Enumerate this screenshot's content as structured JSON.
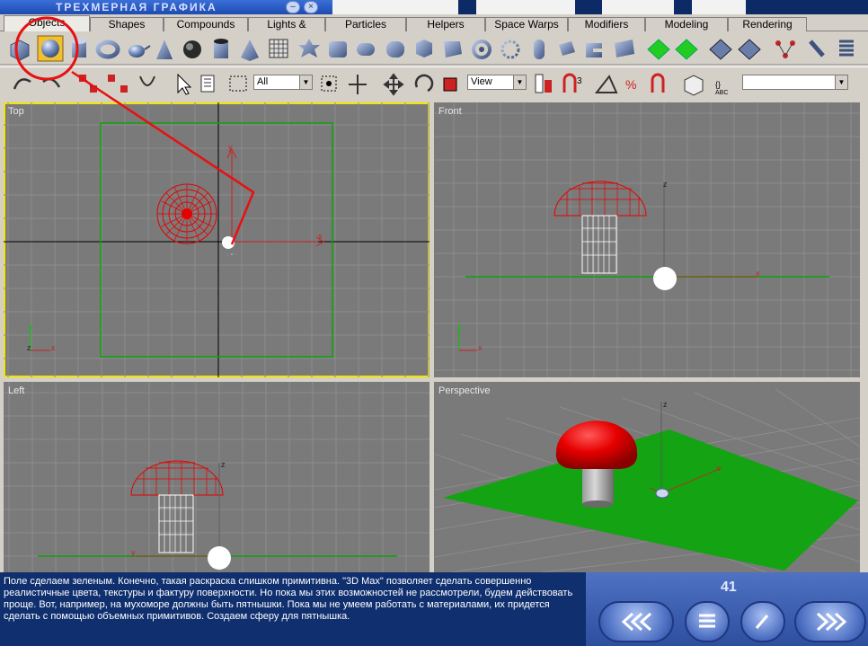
{
  "window": {
    "title": "ТРЕХМЕРНАЯ ГРАФИКА"
  },
  "tabs": [
    {
      "label": "Objects",
      "active": true
    },
    {
      "label": "Shapes"
    },
    {
      "label": "Compounds"
    },
    {
      "label": "Lights & Cameras"
    },
    {
      "label": "Particles"
    },
    {
      "label": "Helpers"
    },
    {
      "label": "Space Warps"
    },
    {
      "label": "Modifiers"
    },
    {
      "label": "Modeling"
    },
    {
      "label": "Rendering"
    }
  ],
  "toolbar": {
    "selection_filter": "All",
    "reference_coord": "View",
    "named_selection": ""
  },
  "viewports": {
    "top": "Top",
    "front": "Front",
    "left": "Left",
    "perspective": "Perspective"
  },
  "axis": {
    "x": "x",
    "y": "y",
    "z": "z"
  },
  "lesson": {
    "text": "Поле сделаем зеленым. Конечно, такая раскраска слишком примитивна. \"3D Max\" позволяет сделать совершенно реалистичные цвета, текстуры и фактуру поверхности. Но пока мы этих возможностей не рассмотрели, будем действовать проще. Вот, например, на мухоморе должны быть пятнышки. Пока мы не умеем работать с материалами, их придется сделать с помощью объемных примитивов. Создаем сферу для пятнышка.",
    "page": "41"
  },
  "colors": {
    "highlight": "#e81010",
    "grid": "#8c8c8c",
    "viewport_bg": "#7a7a7a",
    "ground": "#13a313",
    "mushroom_cap": "#e60000",
    "active_border": "#f2e600",
    "panel_bg": "#0f2f6e"
  },
  "icons": {
    "title_buttons": [
      "minimize-icon",
      "close-icon"
    ],
    "nav": [
      "back-icon",
      "menu-icon",
      "check-icon",
      "forward-icon"
    ]
  }
}
